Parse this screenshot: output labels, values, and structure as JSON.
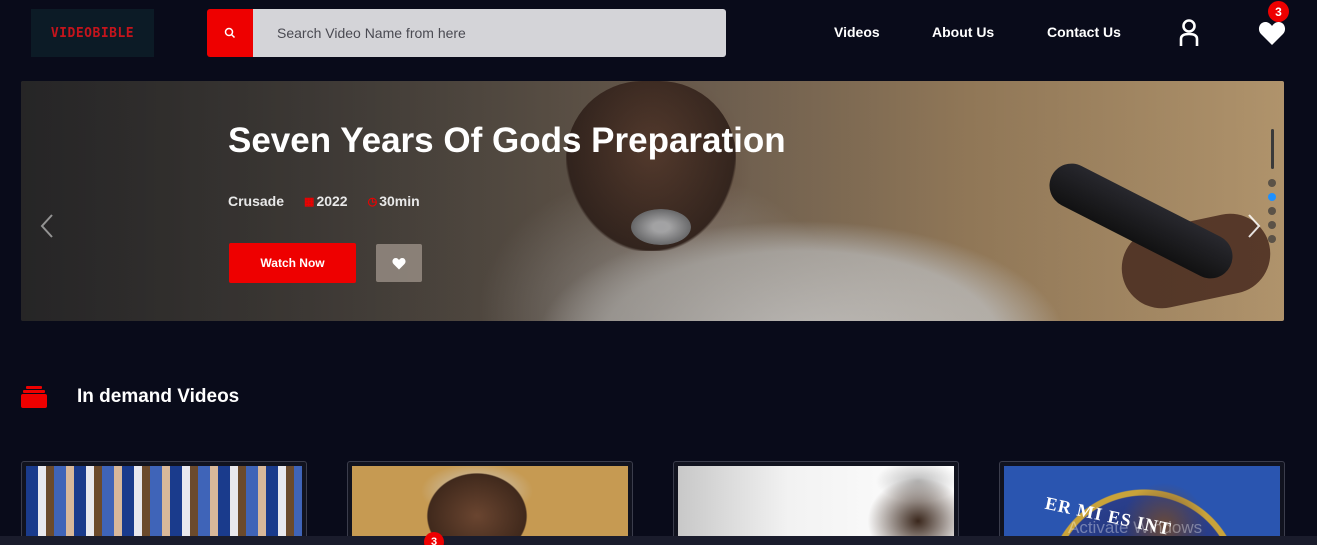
{
  "header": {
    "logo_text": "VIDEOBIBLE",
    "search": {
      "placeholder": "Search Video Name from here"
    },
    "nav": {
      "videos": "Videos",
      "about": "About Us",
      "contact": "Contact Us"
    },
    "favorites_count": "3"
  },
  "hero": {
    "title": "Seven Years Of Gods Preparation",
    "category": "Crusade",
    "year": "2022",
    "duration": "30min",
    "watch_label": "Watch Now",
    "active_slide": 2,
    "slide_count": 5
  },
  "section": {
    "title": "In demand Videos"
  },
  "cards": [
    {
      "thumb_text": ""
    },
    {
      "thumb_text": ""
    },
    {
      "thumb_text": ""
    },
    {
      "thumb_text": "ER MI   ES INT"
    }
  ],
  "bottom_badge": "3",
  "watermark": "Activate Windows",
  "colors": {
    "accent": "#ee0000",
    "background": "#090b1a",
    "active_dot": "#1e90ff"
  }
}
